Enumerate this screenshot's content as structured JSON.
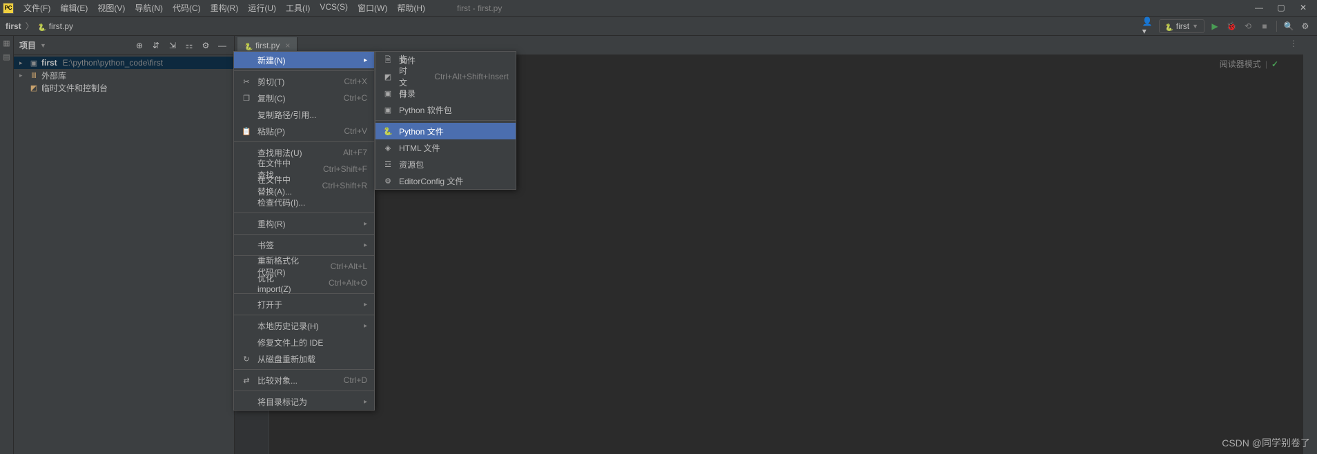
{
  "titlebar": {
    "app_abbrev": "PC",
    "menu": [
      "文件(F)",
      "编辑(E)",
      "视图(V)",
      "导航(N)",
      "代码(C)",
      "重构(R)",
      "运行(U)",
      "工具(I)",
      "VCS(S)",
      "窗口(W)",
      "帮助(H)"
    ],
    "title": "first - first.py"
  },
  "navbar": {
    "breadcrumb": [
      "first",
      "first.py"
    ],
    "run_config": "first"
  },
  "project_panel": {
    "title": "项目",
    "tree": [
      {
        "label": "first",
        "path": "E:\\python\\python_code\\first",
        "icon": "folder",
        "arrow": ">",
        "selected": true,
        "indent": 0
      },
      {
        "label": "外部库",
        "path": "",
        "icon": "lib",
        "arrow": ">",
        "selected": false,
        "indent": 0
      },
      {
        "label": "临时文件和控制台",
        "path": "",
        "icon": "scratch",
        "arrow": "",
        "selected": false,
        "indent": 0
      }
    ]
  },
  "editor": {
    "tab_label": "first.py",
    "reader_mode": "阅读器模式"
  },
  "context_menu_1": [
    {
      "type": "item",
      "label": "新建(N)",
      "shortcut": "",
      "arrow": true,
      "highlighted": true,
      "icon": ""
    },
    {
      "type": "sep"
    },
    {
      "type": "item",
      "label": "剪切(T)",
      "shortcut": "Ctrl+X",
      "icon": "cut"
    },
    {
      "type": "item",
      "label": "复制(C)",
      "shortcut": "Ctrl+C",
      "icon": "copy"
    },
    {
      "type": "item",
      "label": "复制路径/引用...",
      "shortcut": "",
      "icon": ""
    },
    {
      "type": "item",
      "label": "粘贴(P)",
      "shortcut": "Ctrl+V",
      "icon": "paste"
    },
    {
      "type": "sep"
    },
    {
      "type": "item",
      "label": "查找用法(U)",
      "shortcut": "Alt+F7",
      "icon": ""
    },
    {
      "type": "item",
      "label": "在文件中查找...",
      "shortcut": "Ctrl+Shift+F",
      "icon": ""
    },
    {
      "type": "item",
      "label": "在文件中替换(A)...",
      "shortcut": "Ctrl+Shift+R",
      "icon": ""
    },
    {
      "type": "item",
      "label": "检查代码(I)...",
      "shortcut": "",
      "icon": ""
    },
    {
      "type": "sep"
    },
    {
      "type": "item",
      "label": "重构(R)",
      "shortcut": "",
      "arrow": true,
      "icon": ""
    },
    {
      "type": "sep"
    },
    {
      "type": "item",
      "label": "书签",
      "shortcut": "",
      "arrow": true,
      "icon": ""
    },
    {
      "type": "sep"
    },
    {
      "type": "item",
      "label": "重新格式化代码(R)",
      "shortcut": "Ctrl+Alt+L",
      "icon": ""
    },
    {
      "type": "item",
      "label": "优化 import(Z)",
      "shortcut": "Ctrl+Alt+O",
      "icon": ""
    },
    {
      "type": "sep"
    },
    {
      "type": "item",
      "label": "打开于",
      "shortcut": "",
      "arrow": true,
      "icon": ""
    },
    {
      "type": "sep"
    },
    {
      "type": "item",
      "label": "本地历史记录(H)",
      "shortcut": "",
      "arrow": true,
      "icon": ""
    },
    {
      "type": "item",
      "label": "修复文件上的 IDE",
      "shortcut": "",
      "icon": ""
    },
    {
      "type": "item",
      "label": "从磁盘重新加载",
      "shortcut": "",
      "icon": "reload"
    },
    {
      "type": "sep"
    },
    {
      "type": "item",
      "label": "比较对象...",
      "shortcut": "Ctrl+D",
      "icon": "diff"
    },
    {
      "type": "sep"
    },
    {
      "type": "item",
      "label": "将目录标记为",
      "shortcut": "",
      "arrow": true,
      "icon": ""
    }
  ],
  "context_menu_2": [
    {
      "type": "item",
      "label": "文件",
      "icon": "file"
    },
    {
      "type": "item",
      "label": "临时文件",
      "shortcut": "Ctrl+Alt+Shift+Insert",
      "icon": "scratch"
    },
    {
      "type": "item",
      "label": "目录",
      "icon": "folder"
    },
    {
      "type": "item",
      "label": "Python 软件包",
      "icon": "folder"
    },
    {
      "type": "sep"
    },
    {
      "type": "item",
      "label": "Python 文件",
      "icon": "python",
      "highlighted": true
    },
    {
      "type": "item",
      "label": "HTML 文件",
      "icon": "html"
    },
    {
      "type": "item",
      "label": "资源包",
      "icon": "bundle"
    },
    {
      "type": "item",
      "label": "EditorConfig 文件",
      "icon": "gear"
    }
  ],
  "watermark": "CSDN @同学别卷了"
}
